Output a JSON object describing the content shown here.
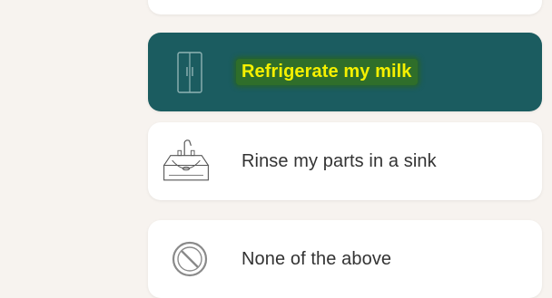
{
  "options": [
    {
      "key": "refrigerate",
      "label": "Refrigerate my milk",
      "icon": "refrigerator-icon",
      "selected": true
    },
    {
      "key": "sink",
      "label": "Rinse my parts in a sink",
      "icon": "sink-icon",
      "selected": false
    },
    {
      "key": "none",
      "label": "None of the above",
      "icon": "prohibited-icon",
      "selected": false
    }
  ],
  "colors": {
    "page_bg": "#f7f3ef",
    "card_bg": "#ffffff",
    "selected_bg": "#1b5c60",
    "selected_text": "#f5f000",
    "highlight": "#2f6e2a"
  }
}
